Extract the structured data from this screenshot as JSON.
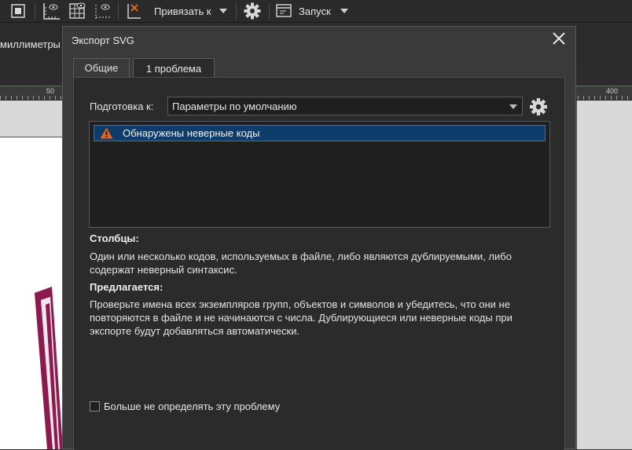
{
  "toolbar": {
    "snap_label": "Привязать к",
    "run_label": "Запуск"
  },
  "units_label": "миллиметры",
  "ruler": {
    "n50": "50",
    "n400": "400"
  },
  "dialog": {
    "title": "Экспорт SVG",
    "tabs": [
      {
        "label": "Общие",
        "active": false
      },
      {
        "label": "1 проблема",
        "active": true
      }
    ],
    "prepare_label": "Подготовка к:",
    "prepare_value": "Параметры по умолчанию",
    "issues": [
      {
        "label": "Обнаружены неверные коды",
        "severity": "warning-icon"
      }
    ],
    "columns_heading": "Столбцы:",
    "columns_text": "Один или несколько кодов, используемых в файле, либо являются дублируемыми, либо содержат неверный синтаксис.",
    "suggest_heading": "Предлагается:",
    "suggest_text": "Проверьте имена всех экземпляров групп, объектов и символов и убедитесь, что они не повторяются в файле и не начинаются с числа. Дублирующиеся или неверные коды при экспорте будут добавляться автоматически.",
    "dont_detect_label": "Больше не определять эту проблему",
    "dont_detect_checked": false
  },
  "colors": {
    "selection": "#0e3d6b",
    "warning": "#e0641e",
    "frame": "#8b1a4e"
  }
}
